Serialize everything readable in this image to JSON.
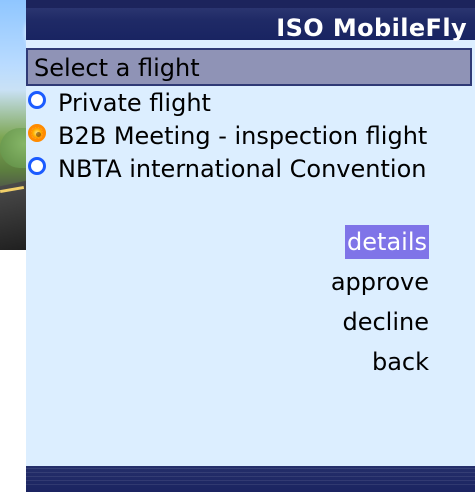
{
  "app": {
    "title": "ISO MobileFly"
  },
  "screen": {
    "section_title": "Select a flight",
    "flights": [
      {
        "label": "Private flight",
        "selected": false
      },
      {
        "label": "B2B Meeting - inspection flight",
        "selected": true
      },
      {
        "label": "NBTA international Convention",
        "selected": false
      }
    ],
    "menu": [
      {
        "label": "details",
        "active": true
      },
      {
        "label": "approve",
        "active": false
      },
      {
        "label": "decline",
        "active": false
      },
      {
        "label": "back",
        "active": false
      }
    ]
  },
  "colors": {
    "window_bg": "#dceeff",
    "titlebar": "#1f2a66",
    "header_bg": "#8f93b6",
    "radio_unselected": "#1b5bff",
    "radio_selected": "#ff8b00",
    "menu_active_bg": "#7f74e8"
  },
  "icons": {
    "radio_unselected": "radio-unselected-icon",
    "radio_selected": "radio-selected-icon"
  }
}
